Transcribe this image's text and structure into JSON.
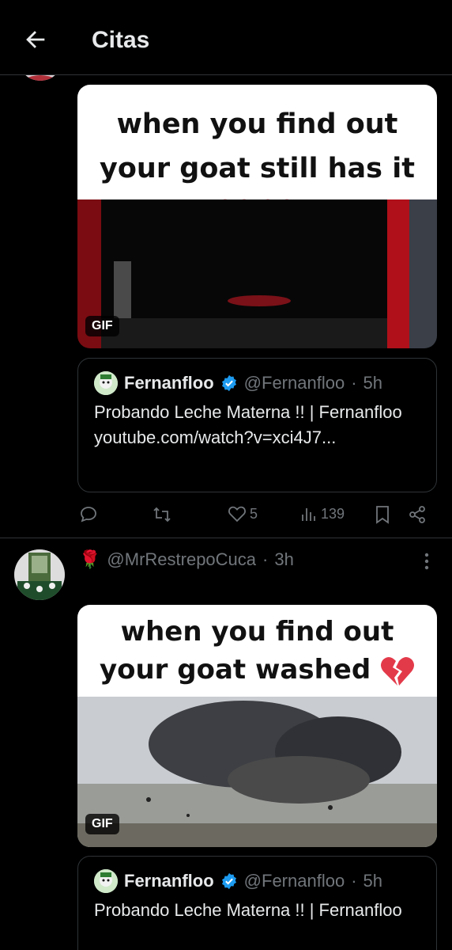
{
  "header": {
    "title": "Citas"
  },
  "post1": {
    "media": {
      "caption": "when you find out your goat still has it",
      "badge": "GIF"
    },
    "quote": {
      "name": "Fernanfloo",
      "handle": "@Fernanfloo",
      "dot": "·",
      "time": "5h",
      "text": "Probando Leche Materna !! | Fernanfloo",
      "link": "youtube.com/watch?v=xci4J7..."
    },
    "actions": {
      "likes": "5",
      "views": "139"
    }
  },
  "post2": {
    "rose": "🌹",
    "handle": "@MrRestrepoCuca",
    "dot": "·",
    "time": "3h",
    "media": {
      "caption": "when you find out your goat washed",
      "badge": "GIF"
    },
    "quote": {
      "name": "Fernanfloo",
      "handle": "@Fernanfloo",
      "dot": "·",
      "time": "5h",
      "text": "Probando Leche Materna !! | Fernanfloo"
    }
  },
  "colors": {
    "background": "#000000",
    "muted": "#71767b",
    "verified": "#1d9bf0",
    "border": "#2f3336"
  }
}
